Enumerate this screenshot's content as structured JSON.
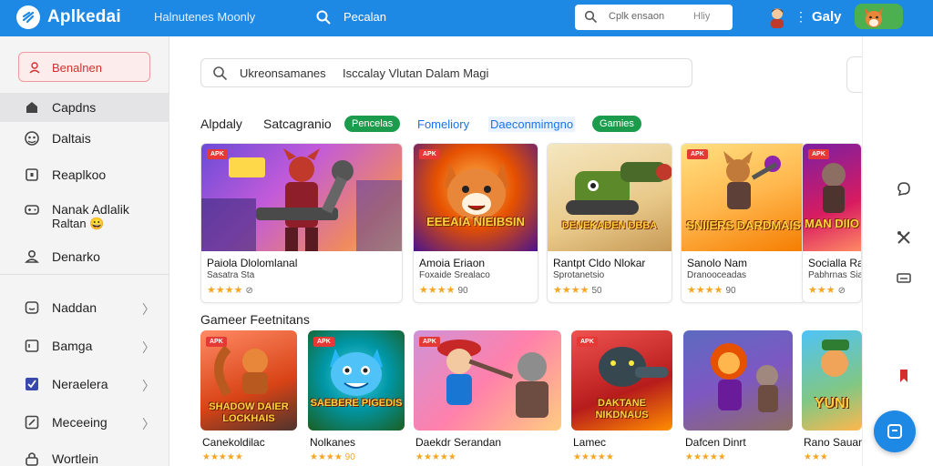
{
  "app": {
    "name": "Aplkedai",
    "tagline": "Halnutenes Moonly",
    "search_label": "Pecalan",
    "search_box_placeholder": "Cplk ensaon",
    "search_box_hint": "Hliy",
    "username": "Galy"
  },
  "sidebar": {
    "primary_button": "Benalnen",
    "items": [
      {
        "label": "Capdns",
        "icon": "home-icon"
      },
      {
        "label": "Daltais",
        "icon": "dashboard-icon"
      },
      {
        "label": "Reaplkoo",
        "icon": "app-icon"
      },
      {
        "label": "Nanak Adlalik",
        "label2": "Raltan 😀",
        "icon": "gamepad-icon"
      },
      {
        "label": "Denarko",
        "icon": "download-icon"
      },
      {
        "label": "Naddan",
        "icon": "chat-icon"
      },
      {
        "label": "Bamga",
        "icon": "folder-icon"
      },
      {
        "label": "Neraelera",
        "icon": "check-icon"
      },
      {
        "label": "Meceeing",
        "icon": "edit-icon"
      },
      {
        "label": "Wortlein",
        "icon": "lock-icon"
      }
    ]
  },
  "main": {
    "search_text": "Ukreonsamanes",
    "search_text2": "Isccalay Vlutan Dalam Magi",
    "tabs": [
      {
        "label": "Alpdaly",
        "style": "plain"
      },
      {
        "label": "Satcagranio",
        "style": "plain"
      },
      {
        "label": "Pencelas",
        "style": "pill"
      },
      {
        "label": "Fomeliory",
        "style": "link"
      },
      {
        "label": "Daeconmimgno",
        "style": "linkbg"
      },
      {
        "label": "Gamies",
        "style": "pill"
      }
    ],
    "featured": [
      {
        "name": "Paiola Dlolomlanal",
        "dev": "Sasatra Sta",
        "rating": "★★★★",
        "count": "⊘",
        "badge": "APK",
        "art_title": ""
      },
      {
        "name": "Amoia Eriaon",
        "dev": "Foxaide Srealaco",
        "rating": "★★★★",
        "count": "90",
        "badge": "APK",
        "art_title": "EEEAIA NIEIBSIN"
      },
      {
        "name": "Rantpt Cldo Nlokar",
        "dev": "Sprotanetsio",
        "rating": "★★★★",
        "count": "50",
        "badge": "",
        "art_title": "DENEKADEN DBBA"
      },
      {
        "name": "Sanolo Nam",
        "dev": "Dranooceadas",
        "rating": "★★★★",
        "count": "90",
        "badge": "APK",
        "art_title": "SNIIERS DARDMAIS"
      },
      {
        "name": "Socialla Ra",
        "dev": "Pabhrnas Siao",
        "rating": "★★★",
        "count": "⊘",
        "badge": "APK",
        "art_title": "MAN DIIO"
      }
    ],
    "section2_title": "Gameer Feetnitans",
    "games": [
      {
        "name": "Canekoldilac",
        "rating": "★★★★★",
        "badge": "APK",
        "art_title": "SHADOW DAIER LOCKHAIS"
      },
      {
        "name": "Nolkanes",
        "rating": "★★★★ 90",
        "badge": "APK",
        "art_title": "SAEBERE PIGEDIS"
      },
      {
        "name": "Daekdr Serandan",
        "rating": "★★★★★",
        "badge": "APK",
        "art_title": ""
      },
      {
        "name": "Lamec",
        "rating": "★★★★★",
        "badge": "APK",
        "art_title": "DAKTANE NIKDNAUS"
      },
      {
        "name": "Dafcen Dinrt",
        "rating": "★★★★★",
        "badge": "",
        "art_title": ""
      },
      {
        "name": "Rano Sauan",
        "rating": "★★★",
        "badge": "",
        "art_title": "YUNI"
      }
    ]
  },
  "colors": {
    "brand": "#1e88e5",
    "accent_green": "#1b9c4c",
    "accent_red": "#d32f2f"
  }
}
